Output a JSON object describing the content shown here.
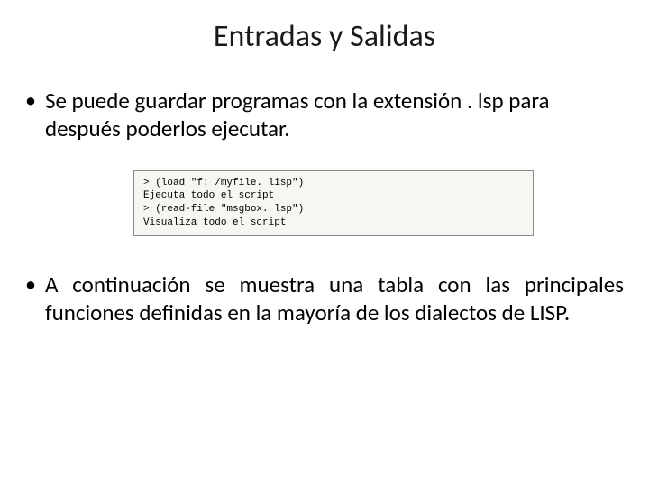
{
  "title": "Entradas y Salidas",
  "bullets": {
    "b1": "Se puede guardar programas con la extensión . lsp para después poderlos ejecutar.",
    "b2": "A continuación se muestra una tabla con las principales funciones definidas en la mayoría de los dialectos de LISP."
  },
  "code": "> (load \"f: /myfile. lisp\")\nEjecuta todo el script\n> (read-file \"msgbox. lsp\")\nVisualiza todo el script"
}
